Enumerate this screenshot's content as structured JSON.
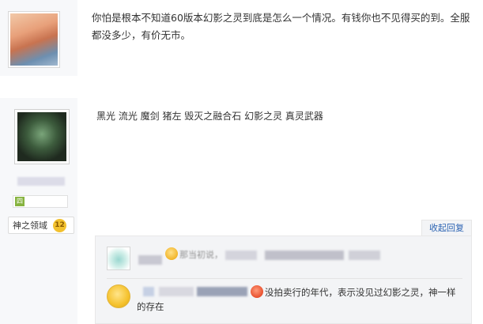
{
  "post1": {
    "text": "你怕是根本不知道60版本幻影之灵到底是怎么一个情况。有钱你也不见得买的到。全服都没多少，有价无市。"
  },
  "post2": {
    "text": "黑光 流光 魔剑 猪左 毁灭之融合石 幻影之灵 真灵武器",
    "level_badge": "四",
    "title_badge": "神之领域",
    "title_level": "12",
    "reply_link": "收起回复"
  },
  "replies": [
    {
      "text": "那当初说，",
      "emoji": "smile-emoji"
    },
    {
      "text": "没拍卖行的年代，表示没见过幻影之灵，神一样",
      "text2": "的存在",
      "emoji": "angry-emoji"
    }
  ],
  "colors": {
    "link": "#2d64b3",
    "sidebar_bg": "#f7f8fa",
    "reply_bg": "#f3f4f6"
  }
}
